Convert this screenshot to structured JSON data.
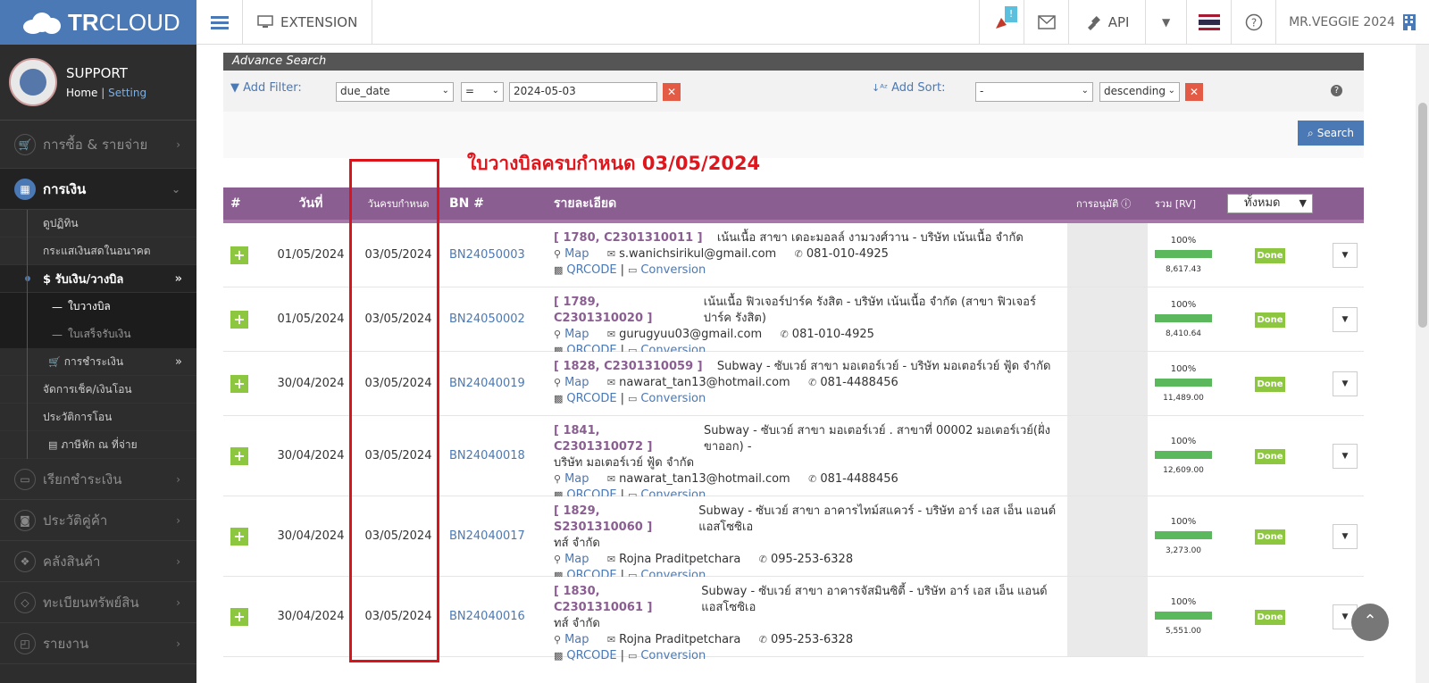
{
  "topbar": {
    "brand": {
      "bold": "TR",
      "light": "CLOUD"
    },
    "extension_label": "EXTENSION",
    "notif_count": "!",
    "api_label": "API",
    "user_label": "MR.VEGGIE 2024"
  },
  "sidebar": {
    "profile": {
      "name": "SUPPORT",
      "home": "Home",
      "separator": "|",
      "setting": "Setting"
    },
    "menu": [
      {
        "label": "การซื้อ & รายจ่าย",
        "icon": "cart-icon"
      },
      {
        "label": "การเงิน",
        "icon": "calendar-icon",
        "active": true
      },
      {
        "label": "เรียกชำระเงิน",
        "icon": "card-icon"
      },
      {
        "label": "ประวัติคู่ค้า",
        "icon": "contact-icon"
      },
      {
        "label": "คลังสินค้า",
        "icon": "cubes-icon"
      },
      {
        "label": "ทะเบียนทรัพย์สิน",
        "icon": "diamond-icon"
      },
      {
        "label": "รายงาน",
        "icon": "report-icon"
      }
    ],
    "finance_sub": [
      {
        "label": "ดูปฏิทิน"
      },
      {
        "label": "กระแสเงินสดในอนาคต"
      },
      {
        "label": "$ รับเงิน/วางบิล",
        "active": true
      },
      {
        "label": "ใบวางบิล",
        "active": true
      },
      {
        "label": "ใบเสร็จรับเงิน"
      },
      {
        "label": "การชำระเงิน"
      },
      {
        "label": "จัดการเช็ค/เงินโอน"
      },
      {
        "label": "ประวัติการโอน"
      },
      {
        "label": "ภาษีหัก ณ ที่จ่าย"
      }
    ]
  },
  "search": {
    "section_title": "Advance Search",
    "add_filter": "Add Filter:",
    "filter_field": "due_date",
    "filter_op": "=",
    "filter_value": "2024-05-03",
    "add_sort": "Add Sort:",
    "sort_field": "-",
    "sort_dir": "descending",
    "search_button": "Search"
  },
  "annotation": "ใบวางบิลครบกำหนด 03/05/2024",
  "table": {
    "headers": {
      "num": "#",
      "date": "วันที่",
      "due": "วันครบกำหนด",
      "bn": "BN #",
      "detail": "รายละเอียด",
      "approval": "การอนุมัติ",
      "total": "รวม [RV]",
      "status_filter": "ทั้งหมด"
    },
    "rows": [
      {
        "date": "01/05/2024",
        "due": "03/05/2024",
        "bn": "BN24050003",
        "code": "[ 1780, C2301310011 ]",
        "desc": "เน้นเนื้อ สาขา เดอะมอลล์ งามวงศ์วาน - บริษัท เน้นเนื้อ จำกัด",
        "desc2": "",
        "email": "s.wanichsirikul@gmail.com",
        "phone": "081-010-4925",
        "pct": "100%",
        "amount": "8,617.43",
        "status": "Done"
      },
      {
        "date": "01/05/2024",
        "due": "03/05/2024",
        "bn": "BN24050002",
        "code": "[ 1789, C2301310020 ]",
        "desc": "เน้นเนื้อ ฟิวเจอร์ปาร์ค รังสิต - บริษัท เน้นเนื้อ จำกัด (สาขา ฟิวเจอร์ปาร์ค รังสิต)",
        "desc2": "",
        "email": "gurugyuu03@gmail.com",
        "phone": "081-010-4925",
        "pct": "100%",
        "amount": "8,410.64",
        "status": "Done"
      },
      {
        "date": "30/04/2024",
        "due": "03/05/2024",
        "bn": "BN24040019",
        "code": "[ 1828, C2301310059 ]",
        "desc": "Subway - ซับเวย์ สาขา มอเตอร์เวย์ - บริษัท มอเตอร์เวย์ ฟู้ด จำกัด",
        "desc2": "",
        "email": "nawarat_tan13@hotmail.com",
        "phone": "081-4488456",
        "pct": "100%",
        "amount": "11,489.00",
        "status": "Done"
      },
      {
        "date": "30/04/2024",
        "due": "03/05/2024",
        "bn": "BN24040018",
        "code": "[ 1841, C2301310072 ]",
        "desc": "Subway - ซับเวย์ สาขา มอเตอร์เวย์ . สาขาที่ 00002 มอเตอร์เวย์(ฝั่งขาออก) -",
        "desc2": "บริษัท มอเตอร์เวย์ ฟู้ด จำกัด",
        "email": "nawarat_tan13@hotmail.com",
        "phone": "081-4488456",
        "pct": "100%",
        "amount": "12,609.00",
        "status": "Done"
      },
      {
        "date": "30/04/2024",
        "due": "03/05/2024",
        "bn": "BN24040017",
        "code": "[ 1829, S2301310060 ]",
        "desc": "Subway - ซับเวย์ สาขา อาคารไทม์สแควร์ - บริษัท อาร์ เอส เอ็น แอนด์ แอสโซซิเอ",
        "desc2": "ทส์ จำกัด",
        "email": "Rojna Praditpetchara",
        "phone": "095-253-6328",
        "pct": "100%",
        "amount": "3,273.00",
        "status": "Done"
      },
      {
        "date": "30/04/2024",
        "due": "03/05/2024",
        "bn": "BN24040016",
        "code": "[ 1830, C2301310061 ]",
        "desc": "Subway - ซับเวย์ สาขา อาคารจัสมินซิตี้ - บริษัท อาร์ เอส เอ็น แอนด์ แอสโซซิเอ",
        "desc2": "ทส์ จำกัด",
        "email": "Rojna Praditpetchara",
        "phone": "095-253-6328",
        "pct": "100%",
        "amount": "5,551.00",
        "status": "Done"
      }
    ],
    "link_map": "Map",
    "link_qr": "QRCODE",
    "link_sep": "|",
    "link_conv": "Conversion"
  }
}
